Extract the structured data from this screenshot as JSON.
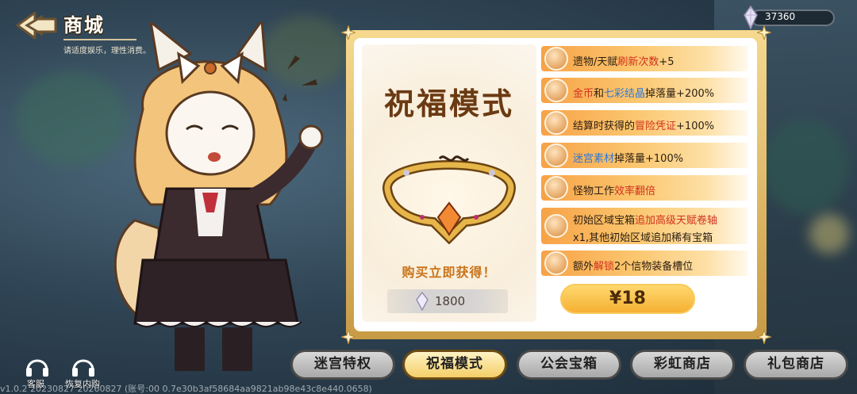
{
  "header": {
    "title": "商城",
    "subtitle": "请适度娱乐，理性消费。"
  },
  "currency": {
    "icon": "crystal-icon",
    "amount": "37360"
  },
  "panel": {
    "mode_title": "祝福模式",
    "reward_item": "blessing-circlet",
    "buy_label": "购买立即获得！",
    "gem_price": "1800",
    "price_button": "¥18",
    "benefits": [
      {
        "icon": "lollipop-icon",
        "parts": [
          "遗物/天赋",
          "刷新次数",
          "+5"
        ]
      },
      {
        "icon": "coin-crystal-icon",
        "parts": [
          "金币",
          "和",
          "七彩结晶",
          "掉落量+200%"
        ]
      },
      {
        "icon": "scroll-icon",
        "parts": [
          "结算时获得的",
          "冒险凭证",
          "+100%"
        ]
      },
      {
        "icon": "plant-icon",
        "parts": [
          "迷宫素材",
          "掉落量+100%"
        ]
      },
      {
        "icon": "clock-icon",
        "parts": [
          "怪物工作",
          "效率翻倍"
        ]
      },
      {
        "icon": "treasure-chest-icon",
        "line1": [
          "初始区域宝箱",
          "追加",
          "高级天赋卷轴"
        ],
        "line2": [
          "x1,其他初始区域",
          "追加",
          "稀有宝箱"
        ]
      },
      {
        "icon": "target-icon",
        "parts": [
          "额外",
          "解锁",
          "2个信物装备槽位"
        ]
      }
    ]
  },
  "tabs": [
    {
      "label": "迷宫特权",
      "active": false
    },
    {
      "label": "祝福模式",
      "active": true
    },
    {
      "label": "公会宝箱",
      "active": false
    },
    {
      "label": "彩虹商店",
      "active": false
    },
    {
      "label": "礼包商店",
      "active": false
    }
  ],
  "bottom_left": {
    "support_label": "客服",
    "restore_label": "恢复内购"
  },
  "version_text": "v1.0.2 20230827 20260827 (账号:00  0.7e30b3af58684aa9821ab98e43c8e440.0658)",
  "colors": {
    "accent_orange": "#f7a247",
    "highlight_red": "#d0311e",
    "highlight_blue": "#2c78d6",
    "title_brown": "#6b3a12",
    "active_tab": "#f4cf68"
  }
}
